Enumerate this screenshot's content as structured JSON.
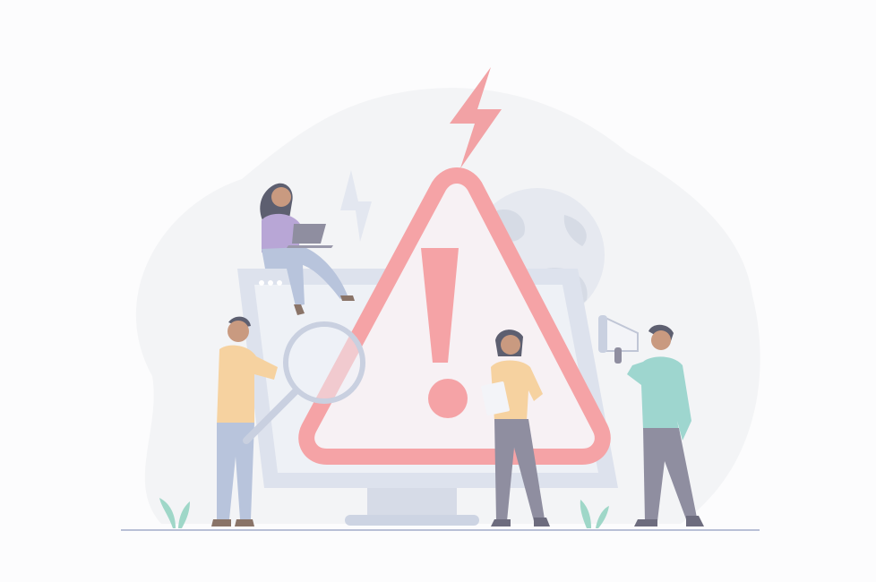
{
  "illustration": {
    "subject": "warning-alert-scene",
    "colors": {
      "background": "#fcfcfd",
      "blob": "#f3f4f6",
      "warning_red": "#f5a3a6",
      "warning_fill": "#f7f1f4",
      "monitor_frame": "#c9d0e0",
      "monitor_screen": "#e3e7f0",
      "globe": "#dde1ea",
      "ground_line": "#b9c0d6",
      "plant": "#9fd7c8",
      "skin": "#c99a80",
      "hair": "#5d5f70",
      "shirt_orange": "#f6d2a0",
      "shirt_green": "#9ed6cf",
      "shirt_purple": "#b8a6d6",
      "pants_blue": "#b8c4dc",
      "pants_gray": "#8f8ea0"
    }
  }
}
